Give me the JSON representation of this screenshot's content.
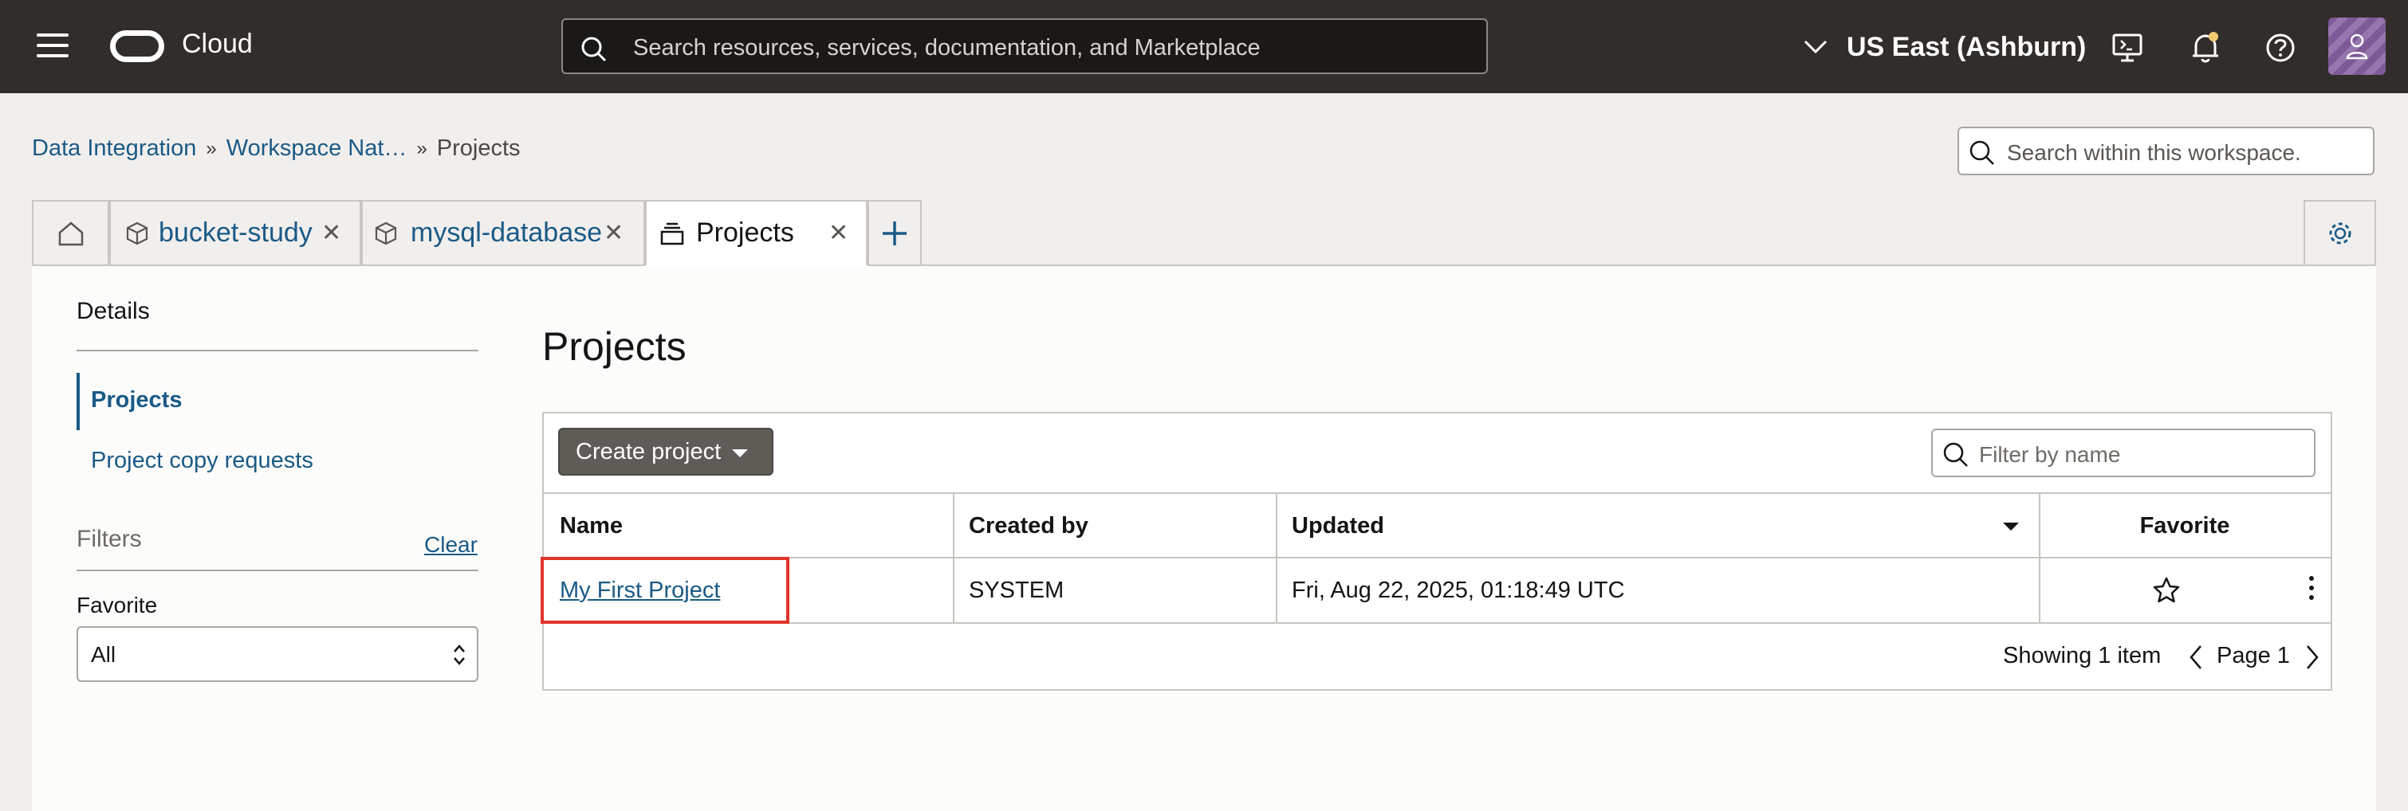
{
  "app": {
    "brand": "Cloud"
  },
  "topbar": {
    "search_placeholder": "Search resources, services, documentation, and Marketplace",
    "region": "US East (Ashburn)",
    "colors": {
      "bar": "#312d2a",
      "notification_dot": "#f0cc71"
    }
  },
  "breadcrumb": {
    "items": [
      "Data Integration",
      "Workspace Nat…",
      "Projects"
    ]
  },
  "workspace_search_placeholder": "Search within this workspace.",
  "tabs": [
    {
      "icon": "home-icon",
      "label": ""
    },
    {
      "icon": "cube-icon",
      "label": "bucket-study"
    },
    {
      "icon": "cube-icon",
      "label": "mysql-database"
    },
    {
      "icon": "stack-icon",
      "label": "Projects",
      "active": true
    }
  ],
  "sidebar": {
    "title": "Details",
    "items": [
      {
        "label": "Projects",
        "active": true
      },
      {
        "label": "Project copy requests"
      }
    ],
    "filters": {
      "title": "Filters",
      "clear_label": "Clear",
      "favorite_label": "Favorite",
      "favorite_value": "All"
    }
  },
  "main": {
    "title": "Projects",
    "create_button": "Create project",
    "filter_placeholder": "Filter by name",
    "columns": [
      "Name",
      "Created by",
      "Updated",
      "Favorite"
    ],
    "rows": [
      {
        "name": "My First Project",
        "created_by": "SYSTEM",
        "updated": "Fri, Aug 22, 2025, 01:18:49 UTC",
        "favorite": false
      }
    ],
    "footer": {
      "showing": "Showing 1 item",
      "page": "Page 1"
    },
    "accent_color": "#1a5a86",
    "highlight_color": "#e1332b"
  }
}
